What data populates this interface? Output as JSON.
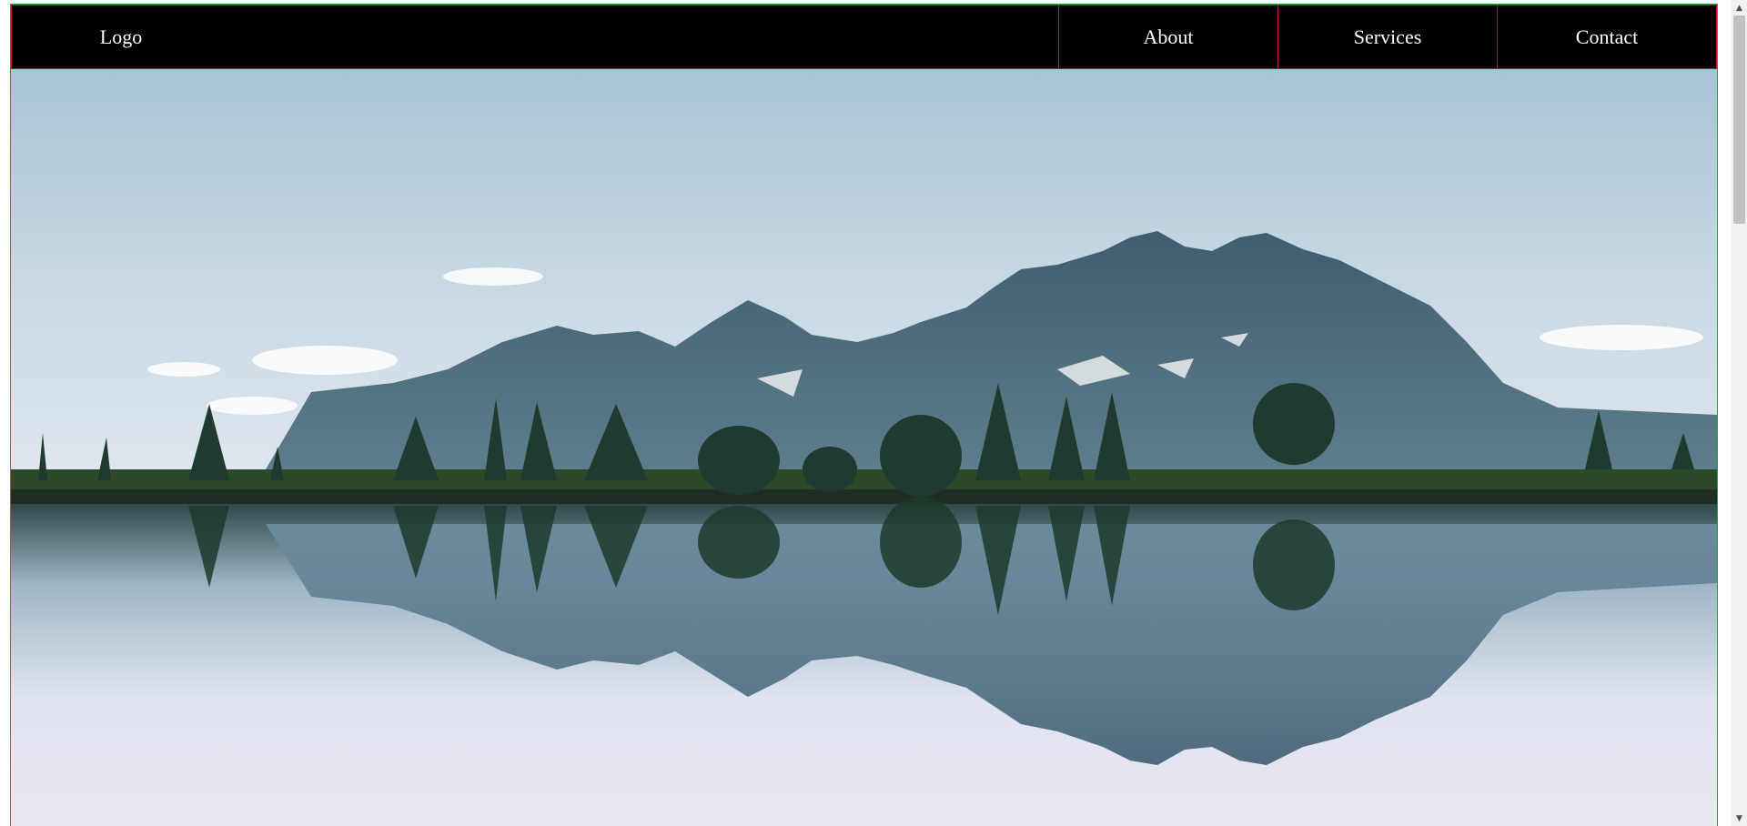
{
  "navbar": {
    "logo": "Logo",
    "items": [
      {
        "label": "About"
      },
      {
        "label": "Services"
      },
      {
        "label": "Contact"
      }
    ]
  },
  "hero": {
    "image": "mountain-lake-reflection-landscape"
  },
  "scrollbar": {
    "up_icon": "▲",
    "down_icon": "▼"
  },
  "colors": {
    "navbar_bg": "#000000",
    "navbar_border": "#c8102e",
    "page_border": "#1f9e3a",
    "nav_text": "#ffffff"
  }
}
